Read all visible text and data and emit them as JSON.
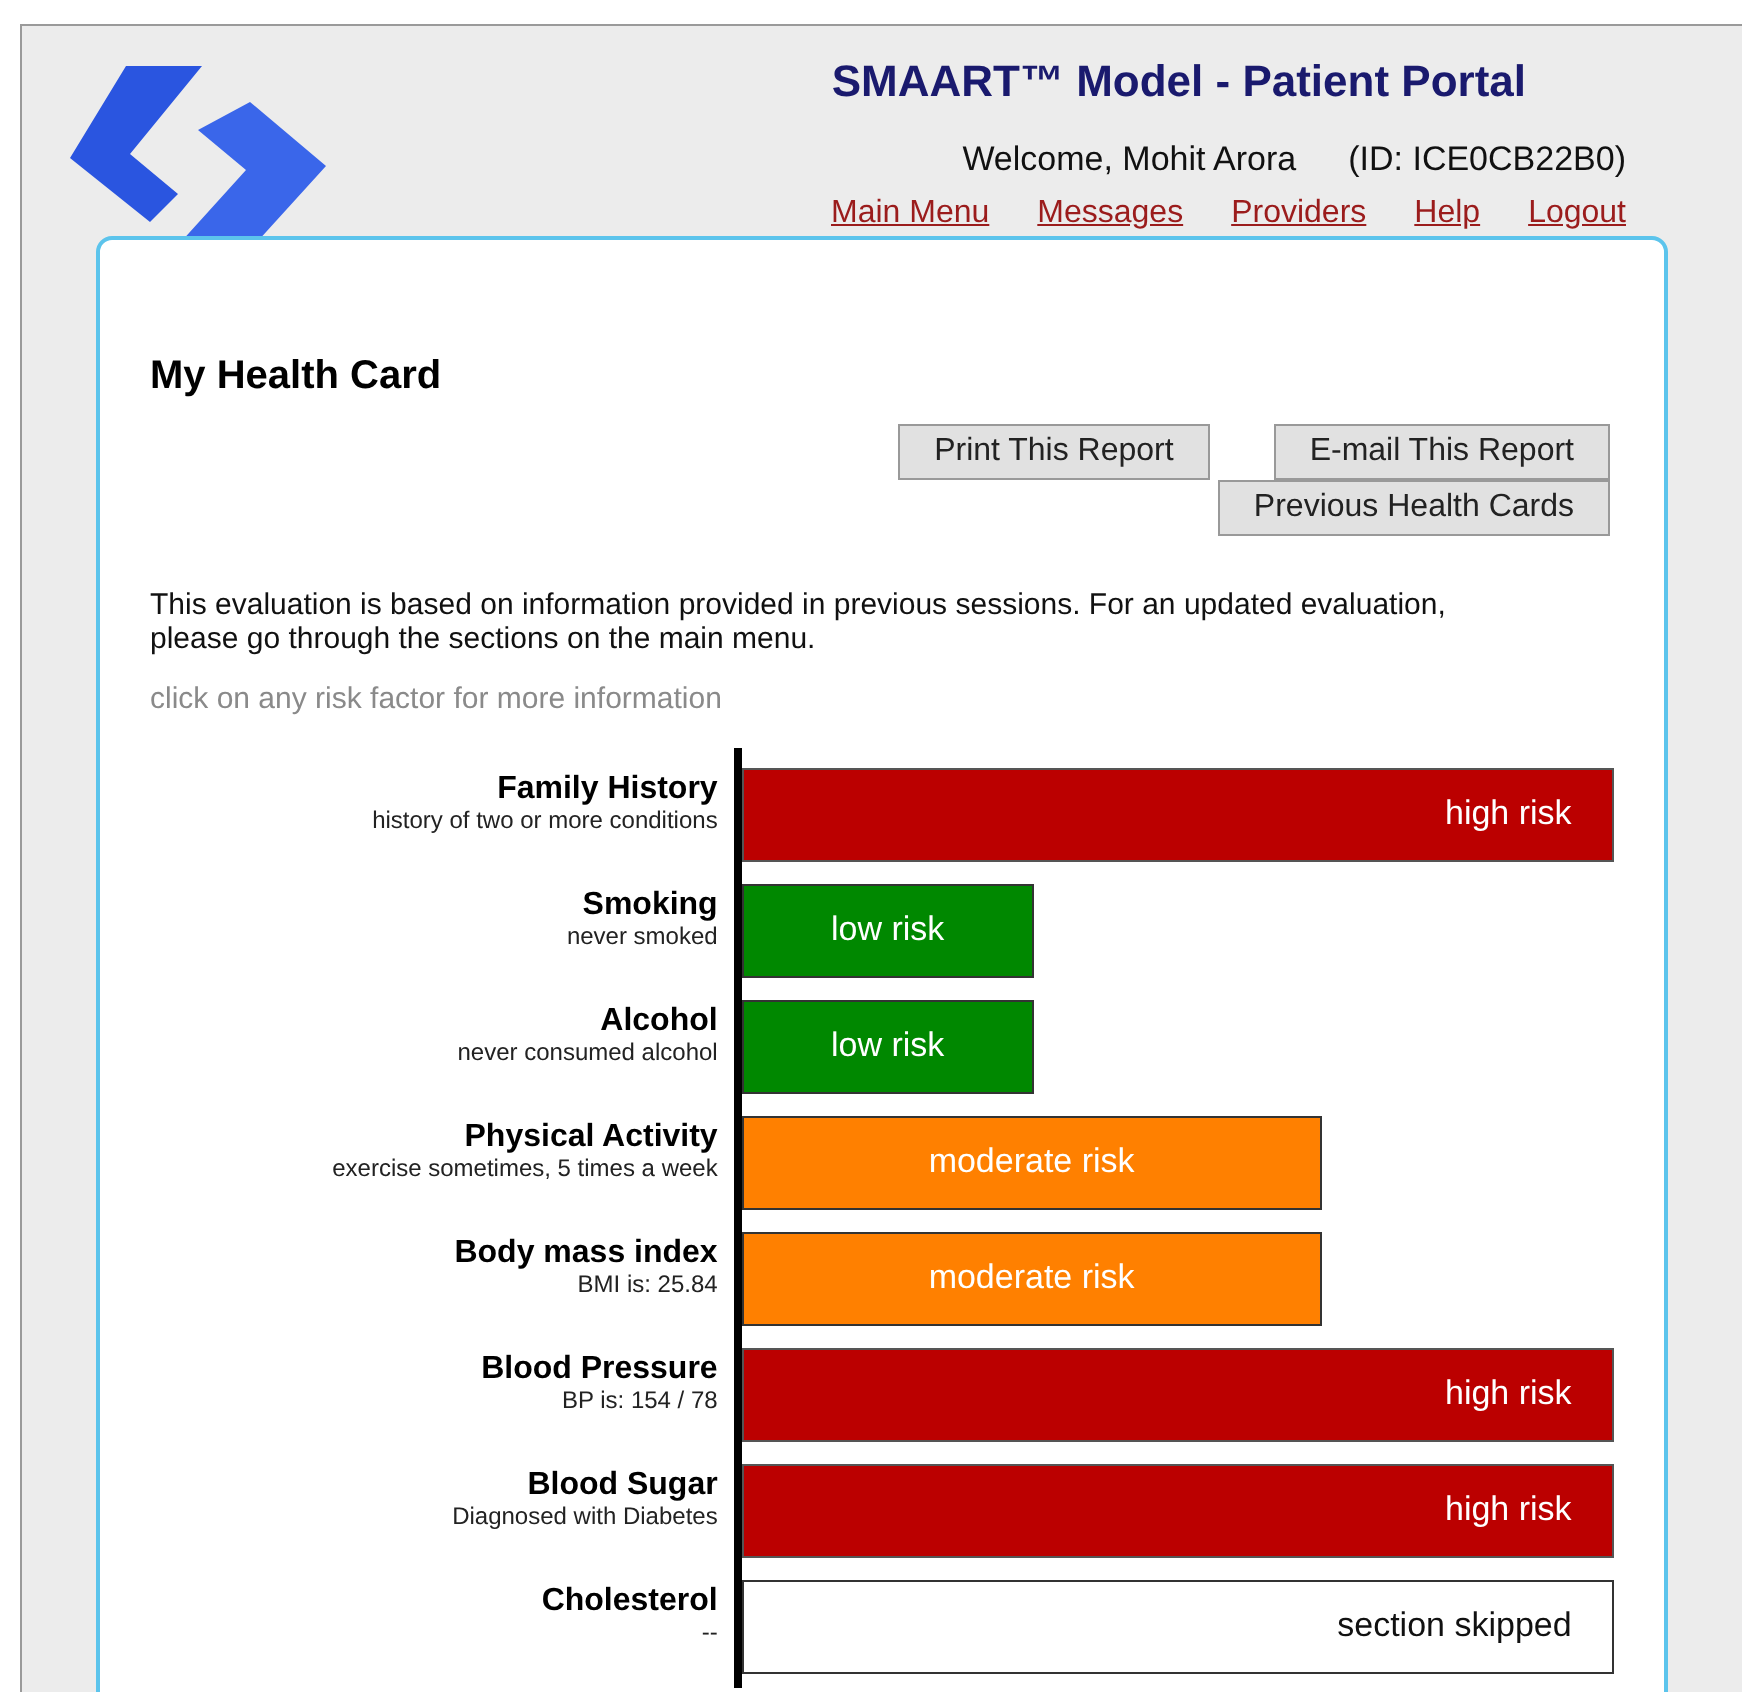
{
  "header": {
    "title": "SMAART™ Model - Patient Portal",
    "welcome": "Welcome, Mohit Arora",
    "patient_id": "(ID: ICE0CB22B0)",
    "links": [
      "Main Menu",
      "Messages",
      "Providers",
      "Help",
      "Logout"
    ]
  },
  "card": {
    "title": "My Health Card",
    "buttons": [
      "Print This Report",
      "E-mail This Report",
      "Previous Health Cards"
    ],
    "intro": "This evaluation is based on information provided in previous sessions. For an updated evaluation, please go through the sections on the main menu.",
    "hint": "click on any risk factor for more information",
    "risk_factors": [
      {
        "name": "Family History",
        "detail": "history of two or more conditions",
        "kind": "high",
        "label": "high risk"
      },
      {
        "name": "Smoking",
        "detail": "never smoked",
        "kind": "low",
        "label": "low risk"
      },
      {
        "name": "Alcohol",
        "detail": "never consumed alcohol",
        "kind": "low",
        "label": "low risk"
      },
      {
        "name": "Physical Activity",
        "detail": "exercise sometimes, 5 times a week",
        "kind": "moderate",
        "label": "moderate risk"
      },
      {
        "name": "Body mass index",
        "detail": "BMI is: 25.84",
        "kind": "moderate",
        "label": "moderate risk"
      },
      {
        "name": "Blood Pressure",
        "detail": "BP is: 154 / 78",
        "kind": "high",
        "label": "high risk"
      },
      {
        "name": "Blood Sugar",
        "detail": "Diagnosed with Diabetes",
        "kind": "high",
        "label": "high risk"
      },
      {
        "name": "Cholesterol",
        "detail": "--",
        "kind": "skipped",
        "label": "section skipped"
      }
    ]
  }
}
